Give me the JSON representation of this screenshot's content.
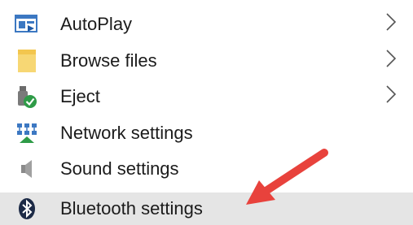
{
  "menu": {
    "items": [
      {
        "label": "AutoPlay",
        "icon": "autoplay-icon",
        "has_submenu": true
      },
      {
        "label": "Browse files",
        "icon": "folder-icon",
        "has_submenu": true
      },
      {
        "label": "Eject",
        "icon": "usb-eject-icon",
        "has_submenu": true
      },
      {
        "label": "Network settings",
        "icon": "network-icon",
        "has_submenu": false
      },
      {
        "label": "Sound settings",
        "icon": "speaker-icon",
        "has_submenu": false
      },
      {
        "label": "Bluetooth settings",
        "icon": "bluetooth-icon",
        "has_submenu": false,
        "highlighted": true
      }
    ]
  },
  "annotation": {
    "arrow_color": "#e8423c"
  },
  "colors": {
    "highlight": "#e5e5e5",
    "text": "#1b1b1b"
  }
}
